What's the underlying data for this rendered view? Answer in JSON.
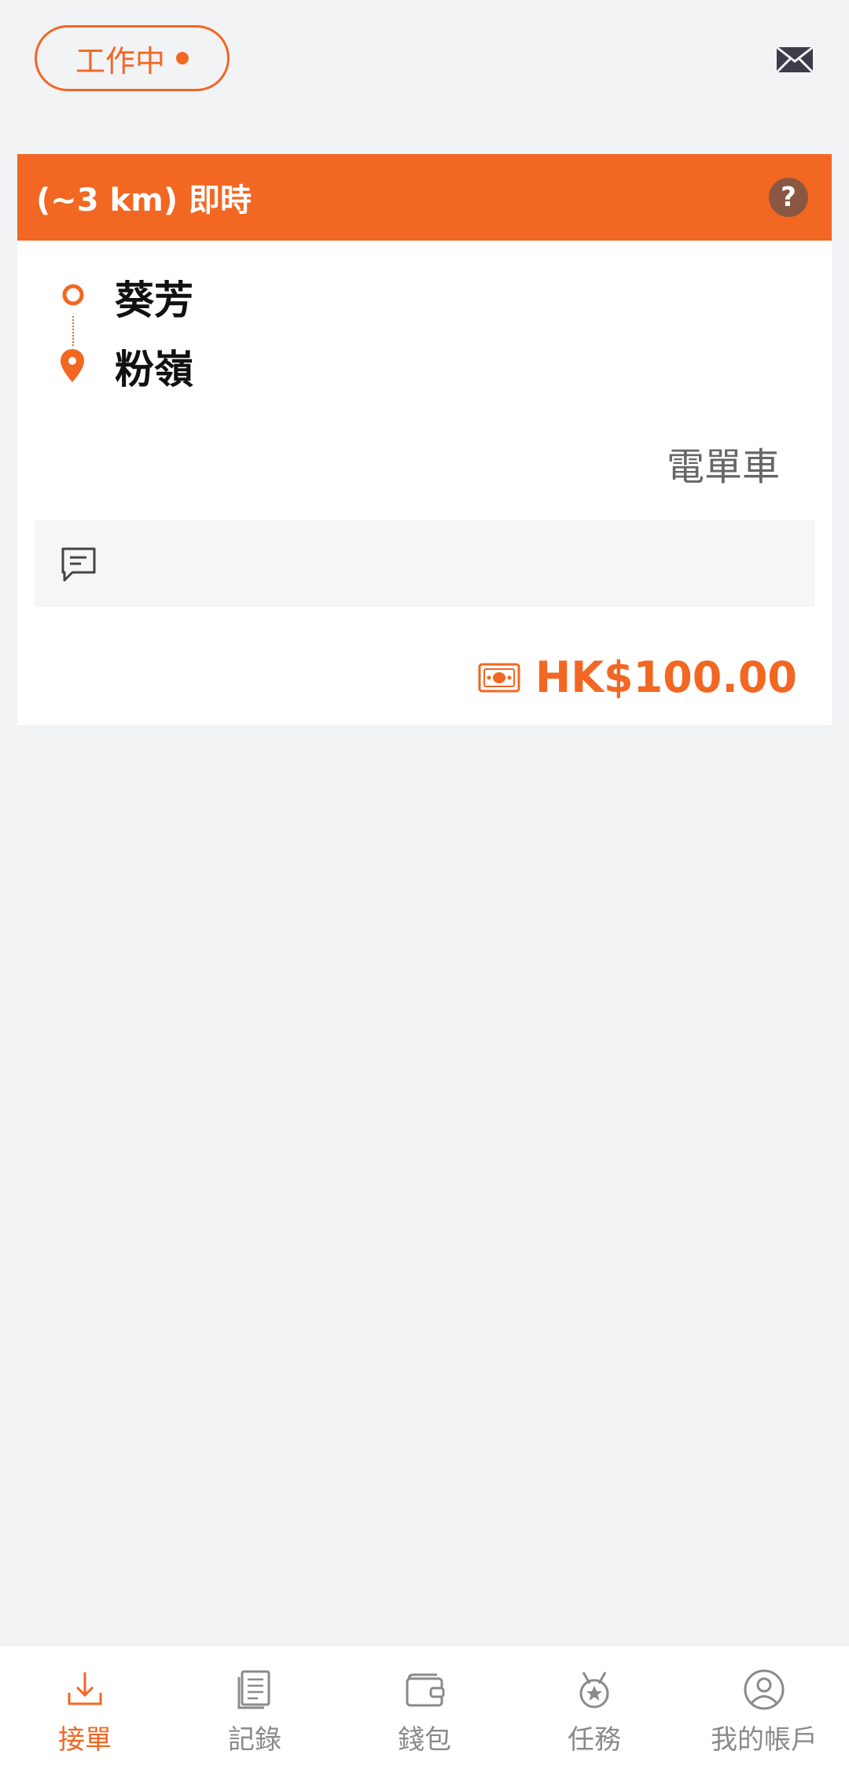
{
  "status": {
    "label": "工作中"
  },
  "header": {
    "mail_icon": "mail-icon"
  },
  "order": {
    "title": "(~3 km) 即時",
    "help_icon": "?",
    "origin": "葵芳",
    "destination": "粉嶺",
    "vehicle_type": "電單車",
    "remark": "",
    "fare": "HK$100.00"
  },
  "tabs": [
    {
      "label": "接單",
      "icon": "download-icon",
      "active": true
    },
    {
      "label": "記錄",
      "icon": "document-icon",
      "active": false
    },
    {
      "label": "錢包",
      "icon": "wallet-icon",
      "active": false
    },
    {
      "label": "任務",
      "icon": "medal-icon",
      "active": false
    },
    {
      "label": "我的帳戶",
      "icon": "account-icon",
      "active": false
    }
  ],
  "colors": {
    "accent": "#f26722",
    "help_bg": "#8a5743",
    "background": "#f2f3f5",
    "tab_inactive": "#8a8a8a"
  }
}
